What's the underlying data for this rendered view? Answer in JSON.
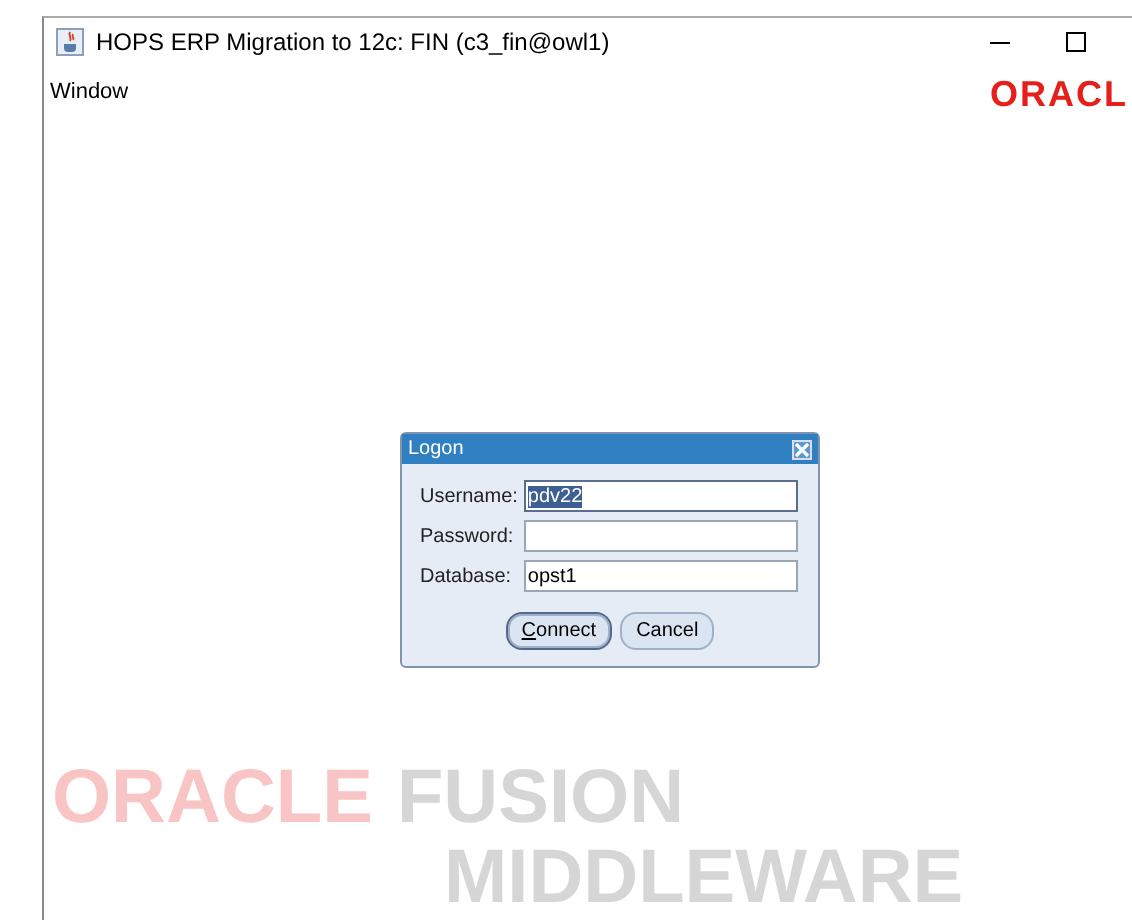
{
  "window": {
    "title": "HOPS ERP Migration to 12c: FIN (c3_fin@owl1)"
  },
  "menu": [
    {
      "label": "Window"
    }
  ],
  "logo": "ORACL",
  "splash": {
    "brand": "ORACLE",
    "line_1": "FUSION",
    "line_2": "MIDDLEWARE"
  },
  "dialog": {
    "title": "Logon",
    "fields": [
      {
        "label": "Username:",
        "value": "pdv22",
        "selected": true
      },
      {
        "label": "Password:",
        "selected": false
      },
      {
        "label": "Database:",
        "value": "opst1",
        "selected": false
      }
    ],
    "buttons": [
      {
        "label": "Connect",
        "default": true
      },
      {
        "label": "Cancel",
        "default": false
      }
    ]
  }
}
